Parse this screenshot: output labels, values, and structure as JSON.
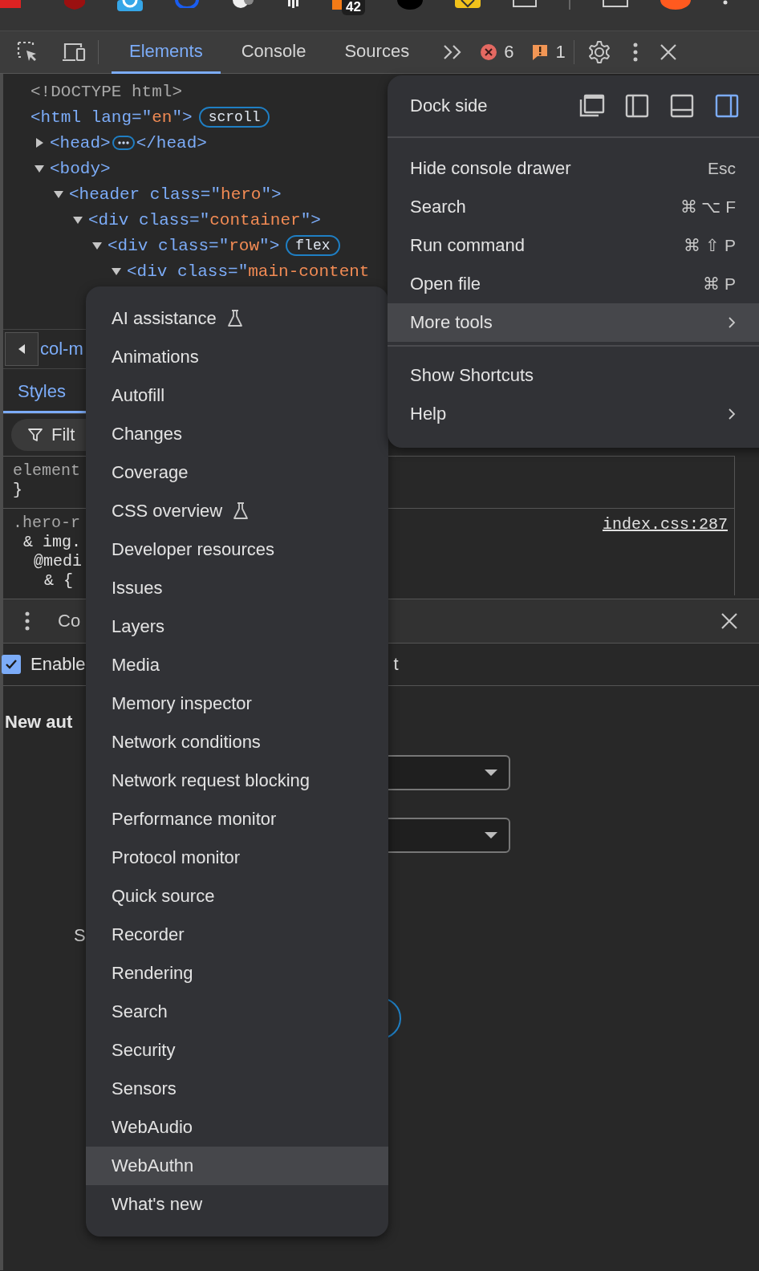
{
  "top_strip": {
    "badge": "42"
  },
  "toolbar": {
    "tabs": [
      {
        "label": "Elements",
        "selected": true
      },
      {
        "label": "Console",
        "selected": false
      },
      {
        "label": "Sources",
        "selected": false
      }
    ],
    "error_count": "6",
    "warning_count": "1"
  },
  "elements_tree": [
    {
      "parts": [
        {
          "kind": "doctype",
          "text": "<!DOCTYPE html>"
        }
      ]
    },
    {
      "parts": [
        {
          "kind": "tag",
          "text": "<html"
        },
        {
          "kind": "attr",
          "text": " lang=\""
        },
        {
          "kind": "value",
          "text": "en"
        },
        {
          "kind": "tag",
          "text": "\">"
        }
      ],
      "badge": "scroll",
      "children": [
        {
          "expanded": false,
          "parts": [
            {
              "kind": "tag",
              "text": "<head>"
            },
            {
              "kind": "ellipsis"
            },
            {
              "kind": "tag",
              "text": "</head>"
            }
          ]
        },
        {
          "expanded": true,
          "parts": [
            {
              "kind": "tag",
              "text": "<body>"
            }
          ],
          "children": [
            {
              "expanded": true,
              "parts": [
                {
                  "kind": "tag",
                  "text": "<header"
                },
                {
                  "kind": "attr",
                  "text": " class=\""
                },
                {
                  "kind": "value",
                  "text": "hero"
                },
                {
                  "kind": "tag",
                  "text": "\">"
                }
              ],
              "children": [
                {
                  "expanded": true,
                  "parts": [
                    {
                      "kind": "tag",
                      "text": "<div"
                    },
                    {
                      "kind": "attr",
                      "text": " class=\""
                    },
                    {
                      "kind": "value",
                      "text": "container"
                    },
                    {
                      "kind": "tag",
                      "text": "\">"
                    }
                  ],
                  "children": [
                    {
                      "expanded": true,
                      "parts": [
                        {
                          "kind": "tag",
                          "text": "<div"
                        },
                        {
                          "kind": "attr",
                          "text": " class=\""
                        },
                        {
                          "kind": "value",
                          "text": "row"
                        },
                        {
                          "kind": "tag",
                          "text": "\">"
                        }
                      ],
                      "badge": "flex",
                      "children": [
                        {
                          "expanded": true,
                          "parts": [
                            {
                              "kind": "tag",
                              "text": "<div"
                            },
                            {
                              "kind": "attr",
                              "text": " class=\""
                            },
                            {
                              "kind": "value",
                              "text": "main-content"
                            }
                          ]
                        }
                      ]
                    }
                  ]
                }
              ]
            }
          ]
        }
      ]
    }
  ],
  "breadcrumb": {
    "text": "col-m"
  },
  "styles_pane": {
    "tab": "Styles",
    "filter_placeholder": "Filt",
    "rules": [
      [
        "element",
        "}"
      ],
      [
        ".hero-r",
        "& img.",
        "@medi",
        "& {"
      ]
    ],
    "source_link": "index.css:287"
  },
  "drawer": {
    "tab": "Co",
    "enable_label": "Enable",
    "enable_checked": true,
    "enable_tail": "t",
    "heading": "New aut",
    "label_fragment": "S"
  },
  "main_menu": {
    "dock_side": {
      "label": "Dock side",
      "options": [
        {
          "kind": "undock",
          "selected": false
        },
        {
          "kind": "left",
          "selected": false
        },
        {
          "kind": "bottom",
          "selected": false
        },
        {
          "kind": "right",
          "selected": true
        }
      ]
    },
    "sections": [
      [
        {
          "label": "Hide console drawer",
          "shortcut": "Esc",
          "submenu": false,
          "selected": false
        },
        {
          "label": "Search",
          "shortcut": "⌘ ⌥ F",
          "submenu": false,
          "selected": false
        },
        {
          "label": "Run command",
          "shortcut": "⌘ ⇧ P",
          "submenu": false,
          "selected": false
        },
        {
          "label": "Open file",
          "shortcut": "⌘ P",
          "submenu": false,
          "selected": false
        },
        {
          "label": "More tools",
          "submenu": true,
          "selected": true
        }
      ],
      [
        {
          "label": "Show Shortcuts",
          "submenu": false,
          "selected": false
        },
        {
          "label": "Help",
          "submenu": true,
          "selected": false
        }
      ]
    ]
  },
  "more_tools_menu": [
    {
      "label": "AI assistance",
      "experimental": true,
      "selected": false
    },
    {
      "label": "Animations",
      "experimental": false,
      "selected": false
    },
    {
      "label": "Autofill",
      "experimental": false,
      "selected": false
    },
    {
      "label": "Changes",
      "experimental": false,
      "selected": false
    },
    {
      "label": "Coverage",
      "experimental": false,
      "selected": false
    },
    {
      "label": "CSS overview",
      "experimental": true,
      "selected": false
    },
    {
      "label": "Developer resources",
      "experimental": false,
      "selected": false
    },
    {
      "label": "Issues",
      "experimental": false,
      "selected": false
    },
    {
      "label": "Layers",
      "experimental": false,
      "selected": false
    },
    {
      "label": "Media",
      "experimental": false,
      "selected": false
    },
    {
      "label": "Memory inspector",
      "experimental": false,
      "selected": false
    },
    {
      "label": "Network conditions",
      "experimental": false,
      "selected": false
    },
    {
      "label": "Network request blocking",
      "experimental": false,
      "selected": false
    },
    {
      "label": "Performance monitor",
      "experimental": false,
      "selected": false
    },
    {
      "label": "Protocol monitor",
      "experimental": false,
      "selected": false
    },
    {
      "label": "Quick source",
      "experimental": false,
      "selected": false
    },
    {
      "label": "Recorder",
      "experimental": false,
      "selected": false
    },
    {
      "label": "Rendering",
      "experimental": false,
      "selected": false
    },
    {
      "label": "Search",
      "experimental": false,
      "selected": false
    },
    {
      "label": "Security",
      "experimental": false,
      "selected": false
    },
    {
      "label": "Sensors",
      "experimental": false,
      "selected": false
    },
    {
      "label": "WebAudio",
      "experimental": false,
      "selected": false
    },
    {
      "label": "WebAuthn",
      "experimental": false,
      "selected": true
    },
    {
      "label": "What's new",
      "experimental": false,
      "selected": false
    }
  ]
}
